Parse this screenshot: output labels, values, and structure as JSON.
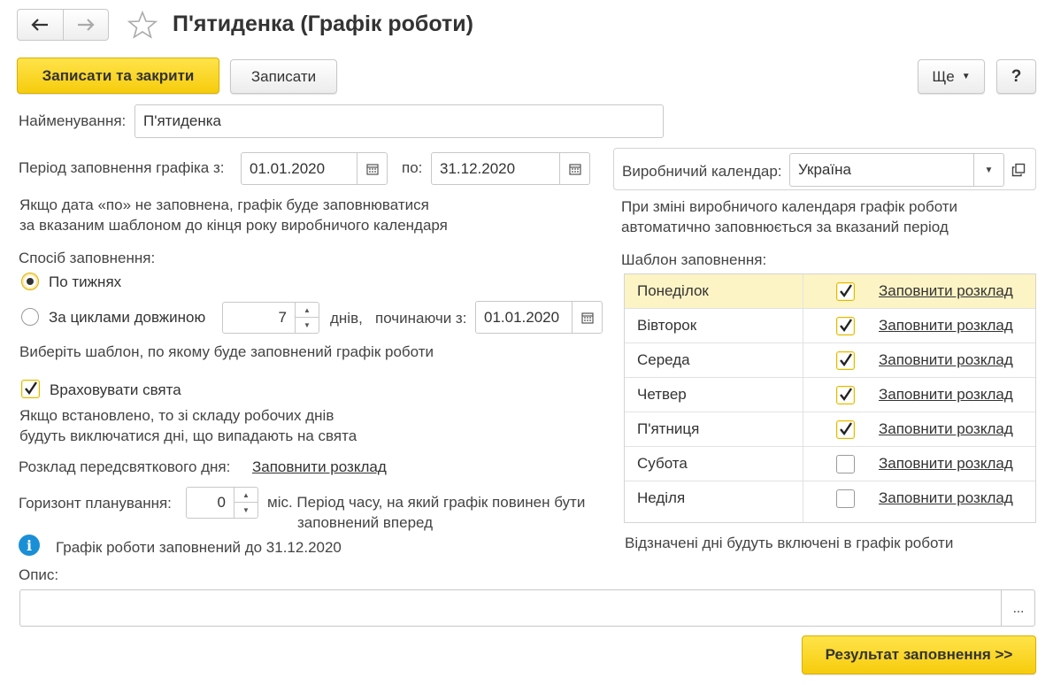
{
  "window": {
    "title": "П'ятиденка (Графік роботи)"
  },
  "toolbar": {
    "save_close": "Записати та закрити",
    "save": "Записати",
    "more": "Ще",
    "help": "?"
  },
  "name": {
    "label": "Найменування:",
    "value": "П'ятиденка"
  },
  "period": {
    "label": "Період заповнення графіка з:",
    "from": "01.01.2020",
    "to_label": "по:",
    "to": "31.12.2020",
    "hint1": "Якщо дата «по» не заповнена, графік буде заповнюватися",
    "hint2": "за вказаним шаблоном до кінця року виробничого календаря"
  },
  "fill_method": {
    "label": "Спосіб заповнення:",
    "weekly": "По тижнях",
    "cycles": "За циклами довжиною",
    "cycle_length": "7",
    "days_label": "днів,",
    "starting_label": "починаючи з:",
    "starting_date": "01.01.2020",
    "hint": "Виберіть шаблон, по якому буде заповнений графік роботи"
  },
  "holidays": {
    "label": "Враховувати свята",
    "checked": true,
    "hint1": "Якщо встановлено, то зі складу робочих днів",
    "hint2": "будуть виключатися дні, що випадають на свята"
  },
  "preholiday": {
    "label": "Розклад передсвяткового дня:",
    "link": "Заповнити розклад"
  },
  "horizon": {
    "label": "Горизонт планування:",
    "value": "0",
    "unit": "міс. Період часу, на який графік повинен бути",
    "unit2": "заповнений вперед"
  },
  "info": {
    "text": "Графік роботи заповнений до 31.12.2020"
  },
  "description": {
    "label": "Опис:",
    "value": "",
    "more": "..."
  },
  "calendar": {
    "label": "Виробничий календар:",
    "value": "Україна",
    "hint1": "При зміні виробничого календаря графік роботи",
    "hint2": "автоматично заповнюється за вказаний період"
  },
  "template": {
    "label": "Шаблон заповнення:",
    "rows": [
      {
        "day": "Понеділок",
        "checked": true,
        "link": "Заповнити розклад"
      },
      {
        "day": "Вівторок",
        "checked": true,
        "link": "Заповнити розклад"
      },
      {
        "day": "Середа",
        "checked": true,
        "link": "Заповнити розклад"
      },
      {
        "day": "Четвер",
        "checked": true,
        "link": "Заповнити розклад"
      },
      {
        "day": "П'ятниця",
        "checked": true,
        "link": "Заповнити розклад"
      },
      {
        "day": "Субота",
        "checked": false,
        "link": "Заповнити розклад"
      },
      {
        "day": "Неділя",
        "checked": false,
        "link": "Заповнити розклад"
      }
    ],
    "hint": "Відзначені дні будуть включені в графік роботи"
  },
  "result_button": "Результат заповнення >>"
}
